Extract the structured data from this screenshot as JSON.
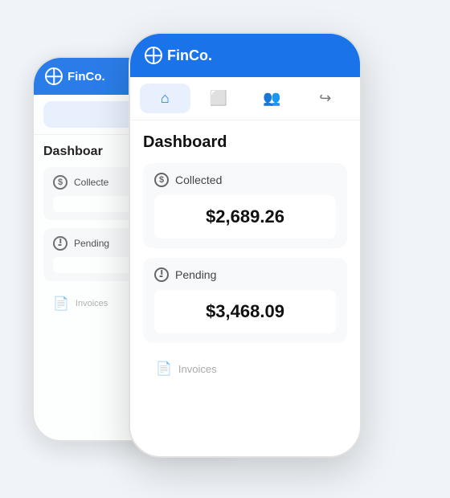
{
  "app": {
    "name": "FinCo.",
    "header_label": "FinCo."
  },
  "nav": {
    "tabs": [
      {
        "id": "home",
        "label": "Home",
        "icon": "🏠",
        "active": true
      },
      {
        "id": "documents",
        "label": "Documents",
        "icon": "📋",
        "active": false
      },
      {
        "id": "users",
        "label": "Users",
        "icon": "👥",
        "active": false
      },
      {
        "id": "logout",
        "label": "Logout",
        "icon": "➡",
        "active": false
      }
    ]
  },
  "dashboard": {
    "title": "Dashboard",
    "cards": [
      {
        "id": "collected",
        "label": "Collected",
        "value": "$2,689.26",
        "icon_type": "dollar"
      },
      {
        "id": "pending",
        "label": "Pending",
        "value": "$3,468.09",
        "icon_type": "clock"
      }
    ],
    "bottom_label": "Invoices"
  }
}
